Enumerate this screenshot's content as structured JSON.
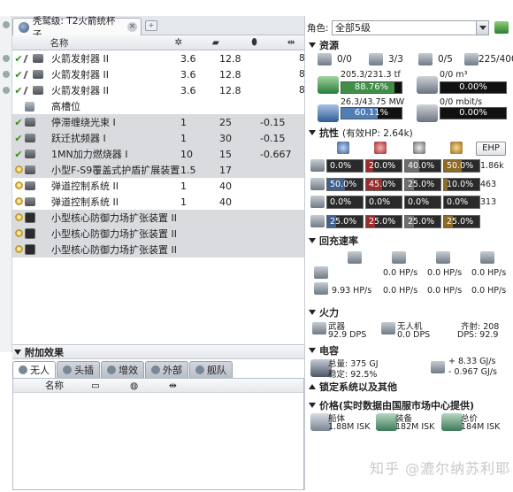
{
  "tab": {
    "title": "秃鹫级: T2火箭统杯子"
  },
  "table": {
    "headers": [
      "名称",
      "",
      "",
      ""
    ],
    "rows": [
      {
        "name": "火箭发射器 II",
        "v1": "3.6",
        "v2": "12.8",
        "v3": "",
        "status": "check",
        "grey": false
      },
      {
        "name": "火箭发射器 II",
        "v1": "3.6",
        "v2": "12.8",
        "v3": "",
        "status": "check",
        "grey": false
      },
      {
        "name": "火箭发射器 II",
        "v1": "3.6",
        "v2": "12.8",
        "v3": "",
        "status": "check",
        "grey": false
      },
      {
        "name": "高槽位",
        "v1": "",
        "v2": "",
        "v3": "",
        "status": "",
        "grey": false
      },
      {
        "name": "停滞缠绕光束 I",
        "v1": "1",
        "v2": "25",
        "v3": "-0.15",
        "status": "check",
        "grey": true
      },
      {
        "name": "跃迁扰频器 I",
        "v1": "1",
        "v2": "30",
        "v3": "-0.15",
        "status": "check",
        "grey": true
      },
      {
        "name": "1MN加力燃烧器 I",
        "v1": "10",
        "v2": "15",
        "v3": "-0.667",
        "status": "check",
        "grey": true
      },
      {
        "name": "小型F-S9覆盖式护盾扩展装置",
        "v1": "1.5",
        "v2": "17",
        "v3": "",
        "status": "ring",
        "grey": true
      },
      {
        "name": "弹道控制系统 II",
        "v1": "1",
        "v2": "40",
        "v3": "",
        "status": "ring",
        "grey": false
      },
      {
        "name": "弹道控制系统 II",
        "v1": "1",
        "v2": "40",
        "v3": "",
        "status": "ring",
        "grey": false
      },
      {
        "name": "小型核心防御力场扩张装置 II",
        "v1": "",
        "v2": "",
        "v3": "",
        "status": "ring",
        "grey": true
      },
      {
        "name": "小型核心防御力场扩张装置 II",
        "v1": "",
        "v2": "",
        "v3": "",
        "status": "ring",
        "grey": true
      },
      {
        "name": "小型核心防御力场扩张装置 II",
        "v1": "",
        "v2": "",
        "v3": "",
        "status": "ring",
        "grey": true
      }
    ],
    "edge_values": [
      "8",
      "8",
      "8"
    ]
  },
  "effects": {
    "title": "附加效果",
    "tabs": [
      "无人",
      "头插",
      "增效",
      "外部",
      "舰队"
    ],
    "col_name": "名称"
  },
  "right": {
    "role_label": "角色:",
    "role_value": "全部5级",
    "resources": {
      "title": "资源",
      "counts": [
        "0/0",
        "3/3",
        "0/5",
        "225/400"
      ],
      "cpu_text": "205.3/231.3 tf",
      "cpu_pct": "88.76%",
      "cpu_fraction": 0.8876,
      "pg_text": "26.3/43.75 MW",
      "pg_pct": "60.11%",
      "pg_fraction": 0.6011,
      "drone_bay": "0/0 m³",
      "drone_bay_pct": "0.00%",
      "bandwidth": "0/0 mbit/s",
      "bandwidth_pct": "0.00%"
    },
    "resist": {
      "title": "抗性",
      "ehp": "(有效HP: 2.64k)",
      "ehp_button": "EHP",
      "rows": [
        {
          "cells": [
            "0.0%",
            "20.0%",
            "40.0%",
            "50.0%"
          ],
          "hp": "1.86k"
        },
        {
          "cells": [
            "50.0%",
            "45.0%",
            "25.0%",
            "10.0%"
          ],
          "hp": "463"
        },
        {
          "cells": [
            "0.0%",
            "0.0%",
            "0.0%",
            "0.0%"
          ],
          "hp": "313"
        },
        {
          "cells": [
            "25.0%",
            "25.0%",
            "25.0%",
            "25.0%"
          ],
          "hp": ""
        }
      ],
      "colors": [
        "#3e5f8f",
        "#9b2c2c",
        "#6d6d6d",
        "#8f6a23"
      ]
    },
    "recharge": {
      "title": "回充速率",
      "row1": [
        "0.0 HP/s",
        "0.0 HP/s",
        "0.0 HP/s"
      ],
      "row2": [
        "9.93 HP/s",
        "0.0 HP/s",
        "0.0 HP/s",
        "0.0 HP/s"
      ]
    },
    "firepower": {
      "title": "火力",
      "weapon_label": "武器",
      "weapon_dps": "92.9 DPS",
      "drone_label": "无人机",
      "drone_dps": "0.0 DPS",
      "volley_label": "齐射: 208",
      "total_dps": "DPS: 92.9"
    },
    "capacitor": {
      "title": "电容",
      "total": "总量: 375 GJ",
      "stable": "稳定: 92.5%",
      "delta_plus": "+ 8.33  GJ/s",
      "delta_minus": "- 0.967 GJ/s"
    },
    "targeting": {
      "title": "锁定系统以及其他"
    },
    "price": {
      "title": "价格(实时数据由国服市场中心提供)",
      "ship_label": "船体",
      "ship_value": "1.88M ISK",
      "fit_label": "装备",
      "fit_value": "182M ISK",
      "total_label": "总价",
      "total_value": "184M ISK"
    }
  },
  "watermark": "知乎 @漉尔纳苏利耶"
}
